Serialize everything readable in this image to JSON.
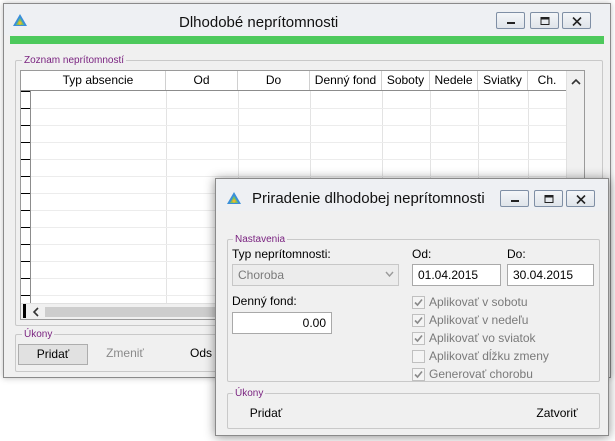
{
  "main_window": {
    "title": "Dlhodobé neprítomnosti",
    "list_group_label": "Zoznam neprítomností",
    "columns": [
      "Typ absencie",
      "Od",
      "Do",
      "Denný fond",
      "Soboty",
      "Nedele",
      "Sviatky",
      "Ch."
    ],
    "actions_group_label": "Úkony",
    "add_label": "Pridať",
    "edit_label": "Zmeniť",
    "remove_label_partial": "Ods"
  },
  "dialog": {
    "title": "Priradenie dlhodobej neprítomnosti",
    "settings_group_label": "Nastavenia",
    "type_label": "Typ neprítomnosti:",
    "type_value": "Choroba",
    "from_label": "Od:",
    "from_value": "01.04.2015",
    "to_label": "Do:",
    "to_value": "30.04.2015",
    "daily_fund_label": "Denný fond:",
    "daily_fund_value": "0.00",
    "checkboxes": [
      {
        "label": "Aplikovať v sobotu",
        "checked": true
      },
      {
        "label": "Aplikovať v nedeľu",
        "checked": true
      },
      {
        "label": "Aplikovať vo sviatok",
        "checked": true
      },
      {
        "label": "Aplikovať dĺžku zmeny",
        "checked": false
      },
      {
        "label": "Generovať chorobu",
        "checked": true
      }
    ],
    "actions_group_label": "Úkony",
    "add_label": "Pridať",
    "close_label": "Zatvoriť"
  },
  "colors": {
    "accent_green": "#4dc95c",
    "group_label_purple": "#7a2380"
  },
  "icons": {
    "app": "app-logo-icon",
    "minimize": "minimize-icon",
    "maximize": "maximize-icon",
    "close": "close-icon"
  }
}
